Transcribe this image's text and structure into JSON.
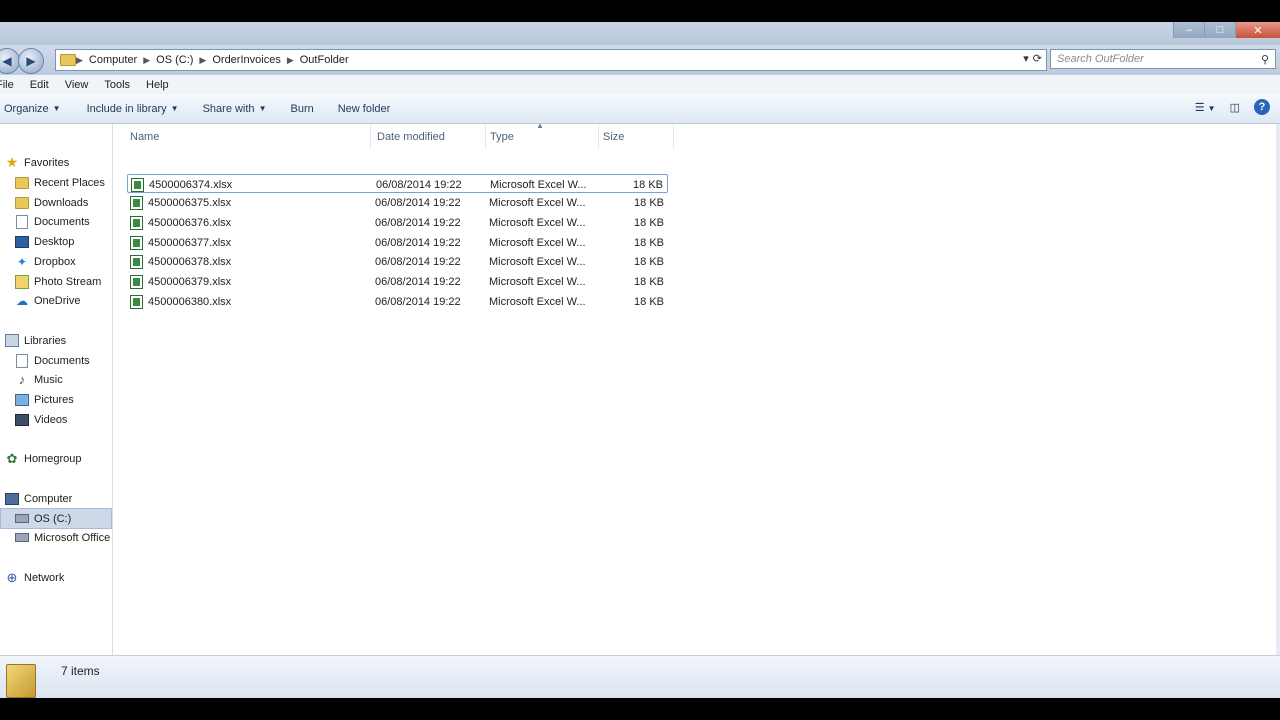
{
  "window": {
    "controls": {
      "minimize": "–",
      "maximize": "□",
      "close": "✕"
    }
  },
  "address": {
    "crumbs": [
      "Computer",
      "OS (C:)",
      "OrderInvoices",
      "OutFolder"
    ],
    "search_placeholder": "Search OutFolder"
  },
  "menu": [
    "File",
    "Edit",
    "View",
    "Tools",
    "Help"
  ],
  "toolbar": {
    "organize": "Organize",
    "include": "Include in library",
    "share": "Share with",
    "burn": "Burn",
    "new_folder": "New folder"
  },
  "nav": {
    "favorites": "Favorites",
    "recent": "Recent Places",
    "downloads": "Downloads",
    "documents": "Documents",
    "desktop": "Desktop",
    "dropbox": "Dropbox",
    "photostream": "Photo Stream",
    "onedrive": "OneDrive",
    "libraries": "Libraries",
    "lib_documents": "Documents",
    "music": "Music",
    "pictures": "Pictures",
    "videos": "Videos",
    "homegroup": "Homegroup",
    "computer": "Computer",
    "os_c": "OS (C:)",
    "ms_office": "Microsoft Office",
    "network": "Network"
  },
  "columns": {
    "name": "Name",
    "date": "Date modified",
    "type": "Type",
    "size": "Size"
  },
  "files": [
    {
      "name": "4500006374.xlsx",
      "date": "06/08/2014 19:22",
      "type": "Microsoft Excel W...",
      "size": "18 KB"
    },
    {
      "name": "4500006375.xlsx",
      "date": "06/08/2014 19:22",
      "type": "Microsoft Excel W...",
      "size": "18 KB"
    },
    {
      "name": "4500006376.xlsx",
      "date": "06/08/2014 19:22",
      "type": "Microsoft Excel W...",
      "size": "18 KB"
    },
    {
      "name": "4500006377.xlsx",
      "date": "06/08/2014 19:22",
      "type": "Microsoft Excel W...",
      "size": "18 KB"
    },
    {
      "name": "4500006378.xlsx",
      "date": "06/08/2014 19:22",
      "type": "Microsoft Excel W...",
      "size": "18 KB"
    },
    {
      "name": "4500006379.xlsx",
      "date": "06/08/2014 19:22",
      "type": "Microsoft Excel W...",
      "size": "18 KB"
    },
    {
      "name": "4500006380.xlsx",
      "date": "06/08/2014 19:22",
      "type": "Microsoft Excel W...",
      "size": "18 KB"
    }
  ],
  "status": {
    "count": "7 items"
  }
}
